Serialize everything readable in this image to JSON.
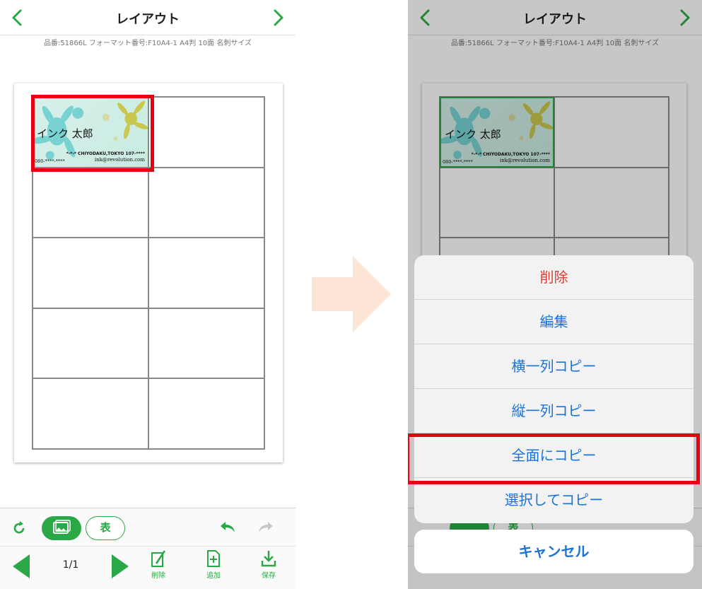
{
  "header": {
    "title": "レイアウト",
    "subtitle": "品番:51866L フォーマット番号:F10A4-1 A4判 10面 名刺サイズ"
  },
  "card": {
    "name": "インク 太郎",
    "address": "*-*-* CHIYODAKU,TOKYO   107-****",
    "tel": "080-****-****",
    "email": "ink@revolution.com"
  },
  "toolbar": {
    "table_label": "表",
    "page_indicator": "1/1",
    "delete_label": "削除",
    "add_label": "追加",
    "save_label": "保存"
  },
  "action_sheet": {
    "items": [
      "削除",
      "編集",
      "横一列コピー",
      "縦一列コピー",
      "全面にコピー",
      "選択してコピー"
    ],
    "cancel": "キャンセル",
    "highlighted_item": "全面にコピー"
  },
  "colors": {
    "accent_green": "#2aa845",
    "highlight_red": "#e60012",
    "action_blue": "#1a73d9",
    "destructive_red": "#e03a2f",
    "arrow_peach": "#fde5d6"
  }
}
